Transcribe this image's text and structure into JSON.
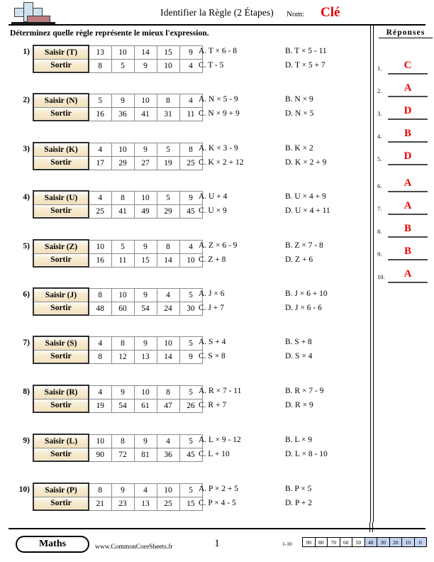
{
  "header": {
    "title": "Identifier la Règle (2 Étapes)",
    "name_label": "Nom:",
    "name_value": "Clé",
    "logo_icon": "plus-block-logo"
  },
  "instruction": "Déterminez quelle règle représente le mieux l'expression.",
  "answers": {
    "title": "Réponses",
    "items": [
      {
        "num": "1.",
        "value": "C"
      },
      {
        "num": "2.",
        "value": "A"
      },
      {
        "num": "3.",
        "value": "D"
      },
      {
        "num": "4.",
        "value": "B"
      },
      {
        "num": "5.",
        "value": "D"
      },
      {
        "num": "6.",
        "value": "A"
      },
      {
        "num": "7.",
        "value": "A"
      },
      {
        "num": "8.",
        "value": "B"
      },
      {
        "num": "9.",
        "value": "B"
      },
      {
        "num": "10.",
        "value": "A"
      }
    ]
  },
  "problems": [
    {
      "num": "1)",
      "input_label": "Saisir (T)",
      "output_label": "Sortir",
      "inputs": [
        "13",
        "10",
        "14",
        "15",
        "9"
      ],
      "outputs": [
        "8",
        "5",
        "9",
        "10",
        "4"
      ],
      "choices": {
        "a": "A. T × 6 - 8",
        "b": "B. T × 5 - 11",
        "c": "C. T - 5",
        "d": "D. T × 5 + 7"
      }
    },
    {
      "num": "2)",
      "input_label": "Saisir (N)",
      "output_label": "Sortir",
      "inputs": [
        "5",
        "9",
        "10",
        "8",
        "4"
      ],
      "outputs": [
        "16",
        "36",
        "41",
        "31",
        "11"
      ],
      "choices": {
        "a": "A. N × 5 - 9",
        "b": "B. N × 9",
        "c": "C. N × 9 + 9",
        "d": "D. N × 5"
      }
    },
    {
      "num": "3)",
      "input_label": "Saisir (K)",
      "output_label": "Sortir",
      "inputs": [
        "4",
        "10",
        "9",
        "5",
        "8"
      ],
      "outputs": [
        "17",
        "29",
        "27",
        "19",
        "25"
      ],
      "choices": {
        "a": "A. K × 3 - 9",
        "b": "B. K × 2",
        "c": "C. K × 2 + 12",
        "d": "D. K × 2 + 9"
      }
    },
    {
      "num": "4)",
      "input_label": "Saisir (U)",
      "output_label": "Sortir",
      "inputs": [
        "4",
        "8",
        "10",
        "5",
        "9"
      ],
      "outputs": [
        "25",
        "41",
        "49",
        "29",
        "45"
      ],
      "choices": {
        "a": "A. U + 4",
        "b": "B. U × 4 + 9",
        "c": "C. U × 9",
        "d": "D. U × 4 + 11"
      }
    },
    {
      "num": "5)",
      "input_label": "Saisir (Z)",
      "output_label": "Sortir",
      "inputs": [
        "10",
        "5",
        "9",
        "8",
        "4"
      ],
      "outputs": [
        "16",
        "11",
        "15",
        "14",
        "10"
      ],
      "choices": {
        "a": "A. Z × 6 - 9",
        "b": "B. Z × 7 - 8",
        "c": "C. Z + 8",
        "d": "D. Z + 6"
      }
    },
    {
      "num": "6)",
      "input_label": "Saisir (J)",
      "output_label": "Sortir",
      "inputs": [
        "8",
        "10",
        "9",
        "4",
        "5"
      ],
      "outputs": [
        "48",
        "60",
        "54",
        "24",
        "30"
      ],
      "choices": {
        "a": "A. J × 6",
        "b": "B. J × 6 + 10",
        "c": "C. J + 7",
        "d": "D. J × 6 - 6"
      }
    },
    {
      "num": "7)",
      "input_label": "Saisir (S)",
      "output_label": "Sortir",
      "inputs": [
        "4",
        "8",
        "9",
        "10",
        "5"
      ],
      "outputs": [
        "8",
        "12",
        "13",
        "14",
        "9"
      ],
      "choices": {
        "a": "A. S + 4",
        "b": "B. S + 8",
        "c": "C. S × 8",
        "d": "D. S × 4"
      }
    },
    {
      "num": "8)",
      "input_label": "Saisir (R)",
      "output_label": "Sortir",
      "inputs": [
        "4",
        "9",
        "10",
        "8",
        "5"
      ],
      "outputs": [
        "19",
        "54",
        "61",
        "47",
        "26"
      ],
      "choices": {
        "a": "A. R × 7 - 11",
        "b": "B. R × 7 - 9",
        "c": "C. R + 7",
        "d": "D. R × 9"
      }
    },
    {
      "num": "9)",
      "input_label": "Saisir (L)",
      "output_label": "Sortir",
      "inputs": [
        "10",
        "8",
        "9",
        "4",
        "5"
      ],
      "outputs": [
        "90",
        "72",
        "81",
        "36",
        "45"
      ],
      "choices": {
        "a": "A. L × 9 - 12",
        "b": "B. L × 9",
        "c": "C. L + 10",
        "d": "D. L × 8 - 10"
      }
    },
    {
      "num": "10)",
      "input_label": "Saisir (P)",
      "output_label": "Sortir",
      "inputs": [
        "8",
        "9",
        "4",
        "10",
        "5"
      ],
      "outputs": [
        "21",
        "23",
        "13",
        "25",
        "15"
      ],
      "choices": {
        "a": "A. P × 2 + 5",
        "b": "B. P × 5",
        "c": "C. P × 4 - 5",
        "d": "D. P + 2"
      }
    }
  ],
  "footer": {
    "subject_badge": "Maths",
    "site_url": "www.CommonCoreSheets.fr",
    "page_number": "1",
    "scale_label": "1-10",
    "scale_values": [
      "90",
      "80",
      "70",
      "60",
      "50",
      "40",
      "30",
      "20",
      "10",
      "0"
    ],
    "scale_highlighted": [
      "40",
      "30",
      "20",
      "10",
      "0"
    ],
    "highlight_color": "#c2d2ef"
  }
}
